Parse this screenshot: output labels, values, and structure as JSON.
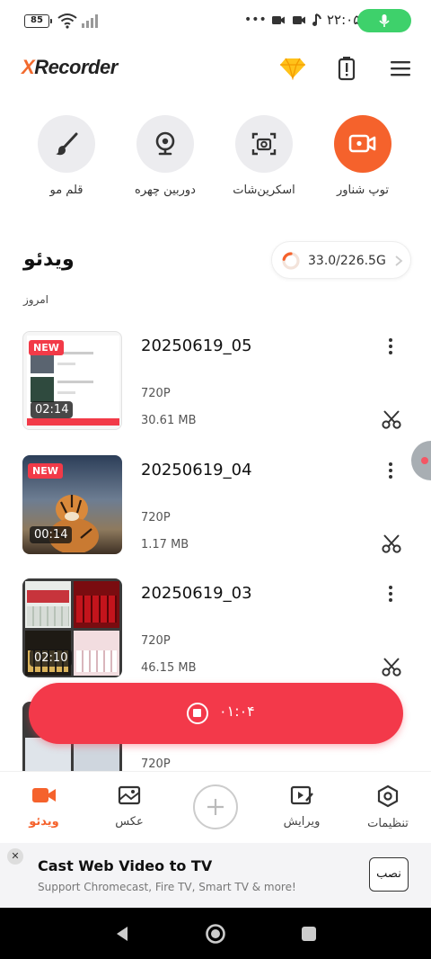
{
  "status_bar": {
    "battery": "85",
    "time": "۲۲:۰۵",
    "dots": "•••"
  },
  "header": {
    "logo_prefix": "X",
    "logo_rest": "Recorder"
  },
  "tools": [
    {
      "label": "قلم مو",
      "icon": "brush-icon"
    },
    {
      "label": "دوربین چهره",
      "icon": "webcam-icon"
    },
    {
      "label": "اسکرین‌شات",
      "icon": "screenshot-icon"
    },
    {
      "label": "توپ شناور",
      "icon": "floating-ball-icon",
      "accent": "#f5622c"
    }
  ],
  "section": {
    "title": "ویدئو",
    "storage": "33.0/226.5G",
    "storage_fraction": 0.146,
    "date_group": "امروز"
  },
  "videos": [
    {
      "title": "20250619_05",
      "resolution": "720P",
      "size": "30.61 MB",
      "duration": "02:14",
      "new": "NEW"
    },
    {
      "title": "20250619_04",
      "resolution": "720P",
      "size": "1.17 MB",
      "duration": "00:14",
      "new": "NEW"
    },
    {
      "title": "20250619_03",
      "resolution": "720P",
      "size": "46.15 MB",
      "duration": "02:10",
      "new": ""
    },
    {
      "title": "",
      "resolution": "720P",
      "size": "",
      "duration": "",
      "new": ""
    }
  ],
  "recording": {
    "time": "۰۱:۰۴",
    "color": "#f3394a"
  },
  "nav": {
    "items": [
      {
        "label": "ویدئو",
        "icon": "video-icon",
        "active": true
      },
      {
        "label": "عکس",
        "icon": "image-icon"
      },
      {
        "label": "ویرایش",
        "icon": "edit-video-icon"
      },
      {
        "label": "تنظیمات",
        "icon": "settings-icon"
      }
    ]
  },
  "ad": {
    "close": "✕",
    "title": "Cast Web Video to TV",
    "subtitle": "Support Chromecast, Fire TV, Smart TV & more!",
    "button": "نصب"
  },
  "colors": {
    "accent": "#f5622c",
    "record": "#f3394a",
    "new_badge": "#f23a48"
  }
}
